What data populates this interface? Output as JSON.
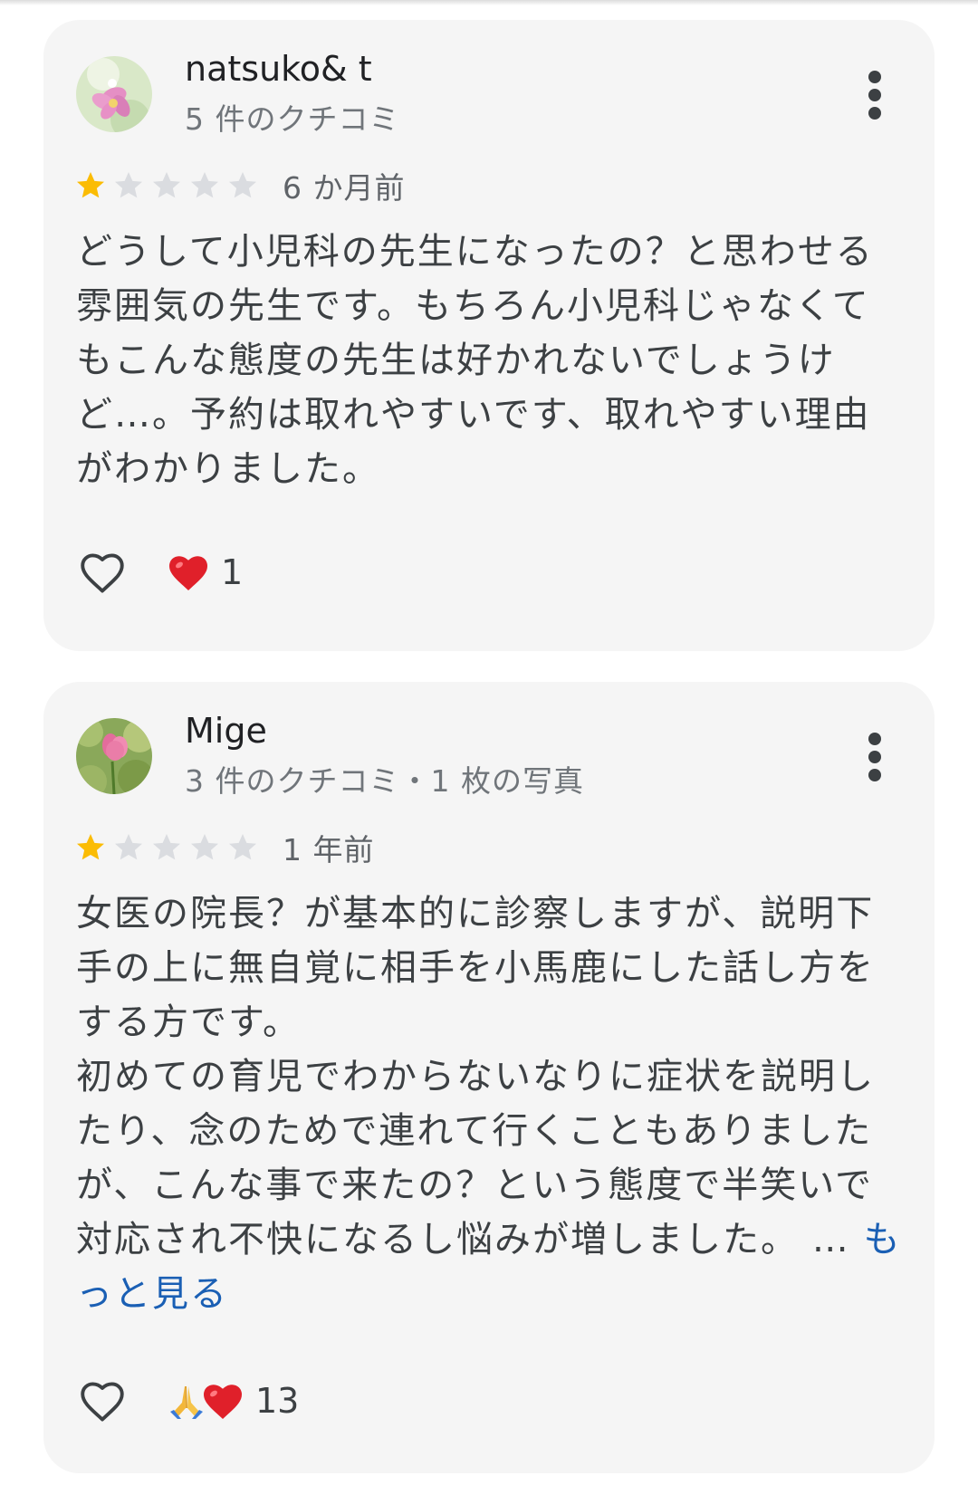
{
  "reviews": [
    {
      "author": "natsuko& t",
      "meta": "5 件のクチコミ",
      "rating": 1,
      "max_rating": 5,
      "time": "6 か月前",
      "body_lines": [
        "どうして小児科の先生になったの？と思わせる",
        "雰囲気の先生です。もちろん小児科じゃなくて",
        "もこんな態度の先生は好かれないでしょうけ",
        "ど…。予約は取れやすいです、取れやすい理由",
        "がわかりました。"
      ],
      "more_link": "",
      "reaction_icons": [
        "heart-emoji"
      ],
      "reaction_count": "1"
    },
    {
      "author": "Mige",
      "meta": "3 件のクチコミ・1 枚の写真",
      "rating": 1,
      "max_rating": 5,
      "time": "1 年前",
      "body_lines": [
        "女医の院長？が基本的に診察しますが、説明下",
        "手の上に無自覚に相手を小馬鹿にした話し方を",
        "する方です。",
        "初めての育児でわからないなりに症状を説明し",
        "たり、念のためで連れて行くこともありました",
        "が、こんな事で来たの？という態度で半笑いで",
        "対応され不快になるし悩みが増しました。 … ",
        ""
      ],
      "more_link_a": "も",
      "more_link_b": "っと見る",
      "reaction_icons": [
        "folded-hands-emoji",
        "heart-emoji"
      ],
      "reaction_count": "13"
    }
  ],
  "colors": {
    "card_bg": "#f5f5f5",
    "star_filled": "#fbbc04",
    "star_empty": "#dadce0",
    "link": "#1a5fb4",
    "heart": "#e0202a"
  }
}
